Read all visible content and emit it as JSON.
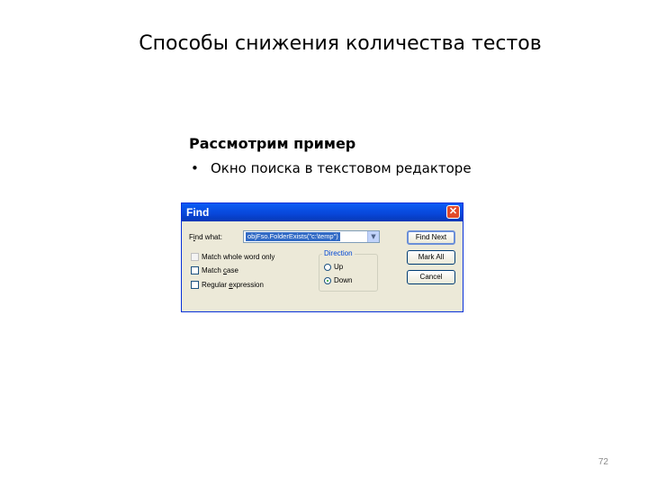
{
  "slide": {
    "title": "Способы снижения количества тестов",
    "subtitle": "Рассмотрим пример",
    "bullet_symbol": "•",
    "bullet_text": "Окно поиска в текстовом редакторе",
    "page_number": "72"
  },
  "dialog": {
    "title": "Find",
    "close_glyph": "✕",
    "find_what_label_prefix": "F",
    "find_what_label_accel": "i",
    "find_what_label_suffix": "nd what:",
    "find_what_value": "objFso.FolderExists(\"c:\\temp\")",
    "match_whole_word": "Match whole word only",
    "match_case_prefix": "Match ",
    "match_case_accel": "c",
    "match_case_suffix": "ase",
    "regex_prefix": "Regular ",
    "regex_accel": "e",
    "regex_suffix": "xpression",
    "direction_label": "Direction",
    "direction_up": "Up",
    "direction_down": "Down",
    "direction_selected": "Down",
    "buttons": {
      "find_next": "Find Next",
      "mark_all": "Mark All",
      "cancel": "Cancel"
    }
  },
  "colors": {
    "titlebar": "#0846d8",
    "dialog_bg": "#ece9d8",
    "selection": "#316ac5"
  }
}
